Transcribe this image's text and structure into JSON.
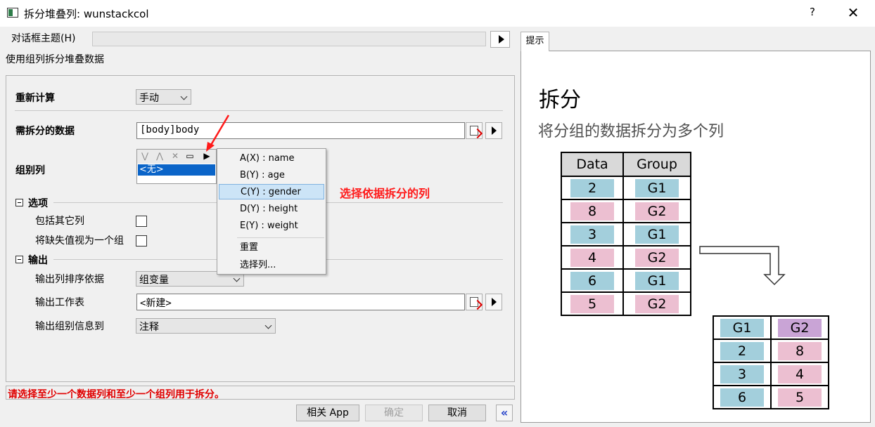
{
  "window": {
    "title": "拆分堆叠列: wunstackcol",
    "help": "?",
    "close": "✕"
  },
  "theme": {
    "label": "对话框主题(H)",
    "value": ""
  },
  "description": "使用组列拆分堆叠数据",
  "form": {
    "recalc_label": "重新计算",
    "recalc_value": "手动",
    "split_data_label": "需拆分的数据",
    "split_data_value": "[body]body",
    "group_col_label": "组别列",
    "group_col_value": "<无>",
    "options_label": "选项",
    "include_other_label": "包括其它列",
    "missing_as_group_label": "将缺失值视为一个组",
    "output_label": "输出",
    "sort_by_label": "输出列排序依据",
    "sort_by_value": "组变量",
    "output_sheet_label": "输出工作表",
    "output_sheet_value": "<新建>",
    "group_info_label": "输出组别信息到",
    "group_info_value": "注释"
  },
  "context_menu": {
    "items": [
      "A(X) : name",
      "B(Y) : age",
      "C(Y) : gender",
      "D(Y) : height",
      "E(Y) : weight"
    ],
    "selected": "C(Y) : gender",
    "reset": "重置",
    "select_cols": "选择列..."
  },
  "annotation": "选择依据拆分的列",
  "status": "请选择至少一个数据列和至少一个组列用于拆分。",
  "buttons": {
    "app": "相关 App",
    "ok": "确定",
    "cancel": "取消",
    "collapse": "«"
  },
  "hint": {
    "tab": "提示",
    "title": "拆分",
    "subtitle": "将分组的数据拆分为多个列",
    "stacked_headers": [
      "Data",
      "Group"
    ],
    "stacked_rows": [
      [
        "2",
        "G1"
      ],
      [
        "8",
        "G2"
      ],
      [
        "3",
        "G1"
      ],
      [
        "4",
        "G2"
      ],
      [
        "6",
        "G1"
      ],
      [
        "5",
        "G2"
      ]
    ],
    "unstacked_headers": [
      "G1",
      "G2"
    ],
    "unstacked_rows": [
      [
        "2",
        "8"
      ],
      [
        "3",
        "4"
      ],
      [
        "6",
        "5"
      ]
    ]
  },
  "colors": {
    "g1": "#a3cfdc",
    "g2": "#ecbfd1",
    "g2_header": "#c9a4d6",
    "status_red": "#e00000",
    "annotation_red": "#ff1a1a"
  }
}
